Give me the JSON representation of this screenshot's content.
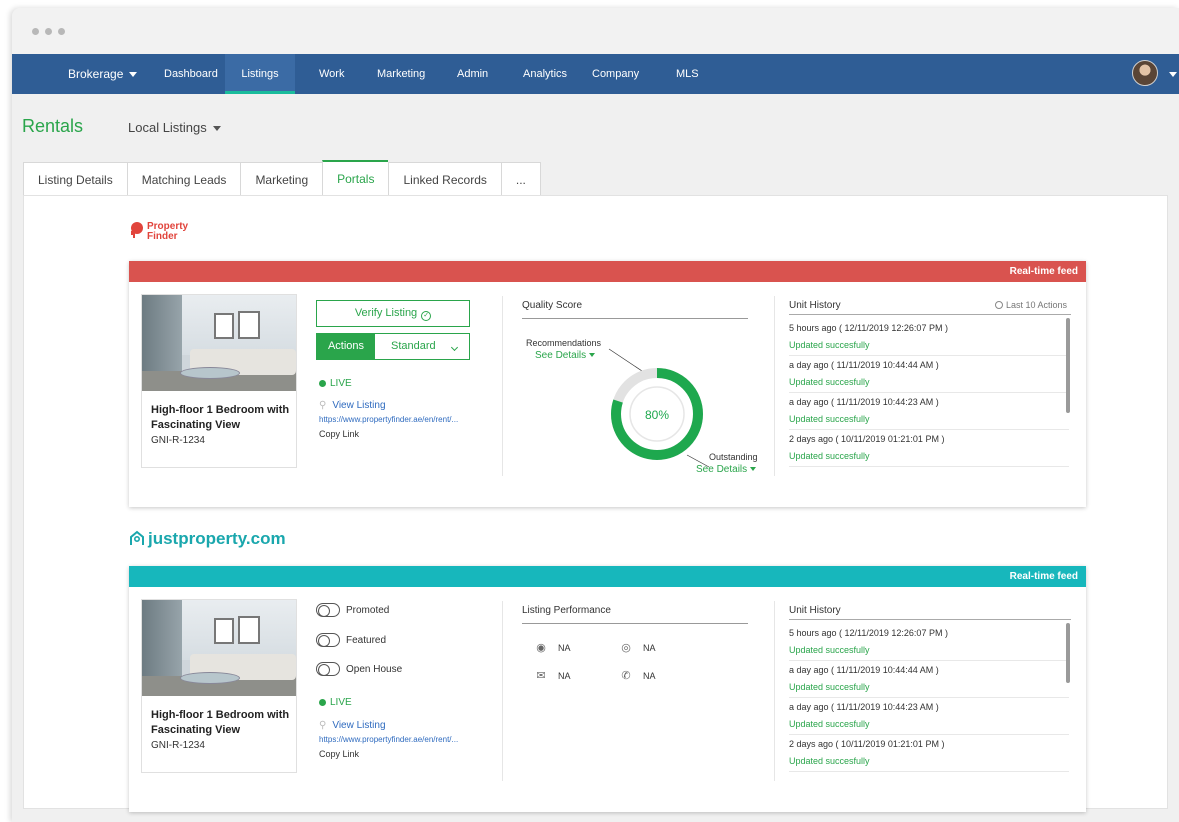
{
  "nav": {
    "brokerage": "Brokerage",
    "items": [
      "Dashboard",
      "Listings",
      "Work",
      "Marketing",
      "Admin",
      "Analytics",
      "Company",
      "MLS"
    ],
    "active": "Listings"
  },
  "page": {
    "title": "Rentals",
    "dropdown": "Local Listings"
  },
  "tabs": [
    "Listing Details",
    "Matching Leads",
    "Marketing",
    "Portals",
    "Linked Records",
    "..."
  ],
  "active_tab": "Portals",
  "portal1": {
    "logo_line1": "Property",
    "logo_line2": "Finder",
    "feed": "Real-time feed",
    "listing_title": "High-floor 1 Bedroom with Fascinating View",
    "listing_code": "GNI-R-1234",
    "verify_label": "Verify Listing",
    "actions_label": "Actions",
    "select_value": "Standard",
    "status": "LIVE",
    "view_listing": "View Listing",
    "url": "https://www.propertyfinder.ae/en/rent/...",
    "copy_link": "Copy Link",
    "quality_title": "Quality Score",
    "recommendations": "Recommendations",
    "outstanding": "Outstanding",
    "see_details": "See Details",
    "score_text": "80%",
    "score_fraction": 0.8,
    "history_title": "Unit History",
    "last_actions": "Last 10 Actions",
    "history": [
      {
        "time": "5 hours ago ( 12/11/2019 12:26:07 PM )",
        "status": "Updated succesfully"
      },
      {
        "time": "a day ago ( 11/11/2019 10:44:44 AM )",
        "status": "Updated succesfully"
      },
      {
        "time": "a day ago ( 11/11/2019 10:44:23 AM )",
        "status": "Updated succesfully"
      },
      {
        "time": "2 days ago ( 10/11/2019 01:21:01 PM )",
        "status": "Updated succesfully"
      }
    ]
  },
  "portal2": {
    "logo": "justproperty.com",
    "feed": "Real-time feed",
    "listing_title": "High-floor 1 Bedroom with Fascinating View",
    "listing_code": "GNI-R-1234",
    "toggles": [
      "Promoted",
      "Featured",
      "Open House"
    ],
    "status": "LIVE",
    "view_listing": "View Listing",
    "url": "https://www.propertyfinder.ae/en/rent/...",
    "copy_link": "Copy Link",
    "performance_title": "Listing Performance",
    "performance": {
      "views": "NA",
      "leads": "NA",
      "emails": "NA",
      "calls": "NA"
    },
    "history_title": "Unit History",
    "history": [
      {
        "time": "5 hours ago ( 12/11/2019 12:26:07 PM )",
        "status": "Updated succesfully"
      },
      {
        "time": "a day ago ( 11/11/2019 10:44:44 AM )",
        "status": "Updated succesfully"
      },
      {
        "time": "a day ago ( 11/11/2019 10:44:23 AM )",
        "status": "Updated succesfully"
      },
      {
        "time": "2 days ago ( 10/11/2019 01:21:01 PM )",
        "status": "Updated succesfully"
      }
    ]
  },
  "colors": {
    "nav": "#2f5d95",
    "accent": "#2aa54b",
    "pf_red": "#d9534f",
    "jp_teal": "#17b7bc"
  }
}
